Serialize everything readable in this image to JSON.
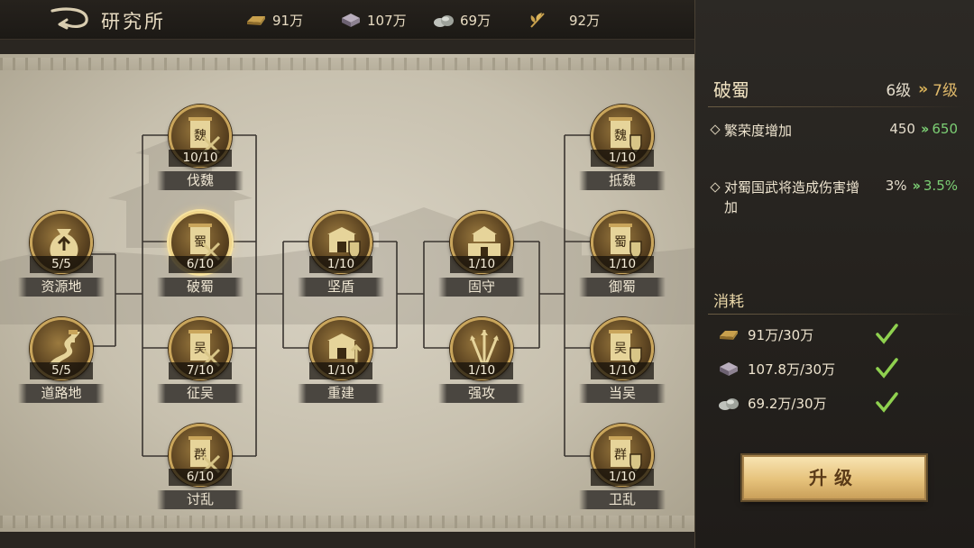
{
  "header": {
    "title": "研究所",
    "resources": [
      {
        "icon": "gold-ingot-icon",
        "value": "91万"
      },
      {
        "icon": "iron-ore-icon",
        "value": "107万"
      },
      {
        "icon": "stone-icon",
        "value": "69万"
      },
      {
        "icon": "grain-icon",
        "value": "92万"
      }
    ]
  },
  "tree": {
    "nodes": [
      {
        "id": "ziyuandi",
        "label": "资源地",
        "progress": "5/5",
        "emblem": "money-bag-icon"
      },
      {
        "id": "daolu",
        "label": "道路地",
        "progress": "5/5",
        "emblem": "road-icon"
      },
      {
        "id": "fawei",
        "label": "伐魏",
        "progress": "10/10",
        "emblem": "banner-wei-swords-icon",
        "glyph": "魏"
      },
      {
        "id": "poshu",
        "label": "破蜀",
        "progress": "6/10",
        "emblem": "banner-shu-swords-icon",
        "glyph": "蜀"
      },
      {
        "id": "zhengwu",
        "label": "征吴",
        "progress": "7/10",
        "emblem": "banner-wu-swords-icon",
        "glyph": "吴"
      },
      {
        "id": "taoluan",
        "label": "讨乱",
        "progress": "6/10",
        "emblem": "banner-qun-swords-icon",
        "glyph": "群"
      },
      {
        "id": "jiandun",
        "label": "坚盾",
        "progress": "1/10",
        "emblem": "city-shield-icon"
      },
      {
        "id": "chongjian",
        "label": "重建",
        "progress": "1/10",
        "emblem": "city-rebuild-icon"
      },
      {
        "id": "gushou",
        "label": "固守",
        "progress": "1/10",
        "emblem": "city-wall-icon"
      },
      {
        "id": "qianggong",
        "label": "强攻",
        "progress": "1/10",
        "emblem": "spears-icon"
      },
      {
        "id": "diwei",
        "label": "抵魏",
        "progress": "1/10",
        "emblem": "banner-wei-shield-icon",
        "glyph": "魏"
      },
      {
        "id": "yushu",
        "label": "御蜀",
        "progress": "1/10",
        "emblem": "banner-shu-shield-icon",
        "glyph": "蜀"
      },
      {
        "id": "dangwu",
        "label": "当吴",
        "progress": "1/10",
        "emblem": "banner-wu-shield-icon",
        "glyph": "吴"
      },
      {
        "id": "weiluan",
        "label": "卫乱",
        "progress": "1/10",
        "emblem": "banner-qun-shield-icon",
        "glyph": "群"
      }
    ],
    "selected": "poshu"
  },
  "panel": {
    "title": "破蜀",
    "level_from": "6级",
    "level_to": "7级",
    "stats": [
      {
        "name": "繁荣度增加",
        "from": "450",
        "to": "650"
      },
      {
        "name": "对蜀国武将造成伤害增加",
        "from": "3%",
        "to": "3.5%"
      }
    ],
    "cost_title": "消耗",
    "costs": [
      {
        "icon": "gold-ingot-icon",
        "text": "91万/30万",
        "met": true
      },
      {
        "icon": "iron-ore-icon",
        "text": "107.8万/30万",
        "met": true
      },
      {
        "icon": "stone-icon",
        "text": "69.2万/30万",
        "met": true
      }
    ],
    "upgrade_label": "升级"
  },
  "colors": {
    "gold": "#c9a55b",
    "increase_green": "#7ccf74",
    "check_green": "#8fd14f",
    "panel_bg": "#2a2723"
  }
}
